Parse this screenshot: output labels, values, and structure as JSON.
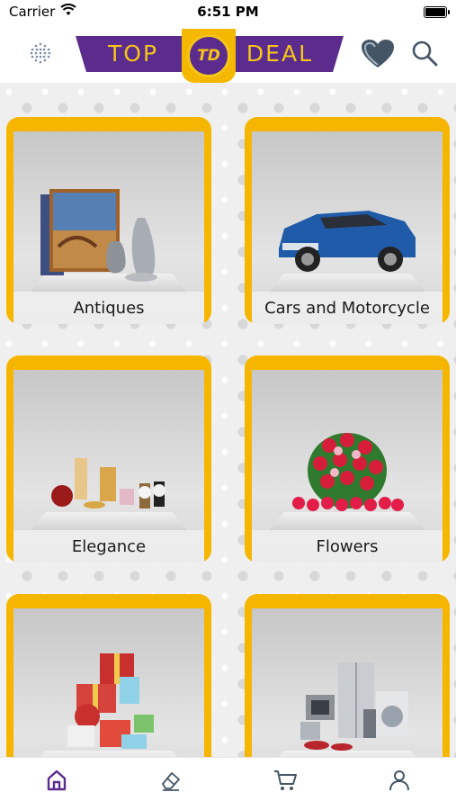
{
  "status_bar": {
    "carrier": "Carrier",
    "time": "6:51 PM"
  },
  "header": {
    "logo_left": "TOP",
    "logo_right": "DEAL",
    "logo_badge": "TD",
    "colors": {
      "brand_purple": "#5b2b8e",
      "brand_yellow": "#f5b800"
    }
  },
  "categories": [
    {
      "label": "Antiques",
      "icon": "antiques-image"
    },
    {
      "label": "Cars and Motorcycle",
      "icon": "car-image"
    },
    {
      "label": "Elegance",
      "icon": "perfume-watch-image"
    },
    {
      "label": "Flowers",
      "icon": "flowers-image"
    },
    {
      "label": "",
      "icon": "gifts-image"
    },
    {
      "label": "",
      "icon": "appliances-image"
    }
  ],
  "tab_bar": {
    "items": [
      {
        "icon": "home-icon",
        "active": true
      },
      {
        "icon": "eraser-icon",
        "active": false
      },
      {
        "icon": "cart-icon",
        "active": false
      },
      {
        "icon": "profile-icon",
        "active": false
      }
    ]
  }
}
